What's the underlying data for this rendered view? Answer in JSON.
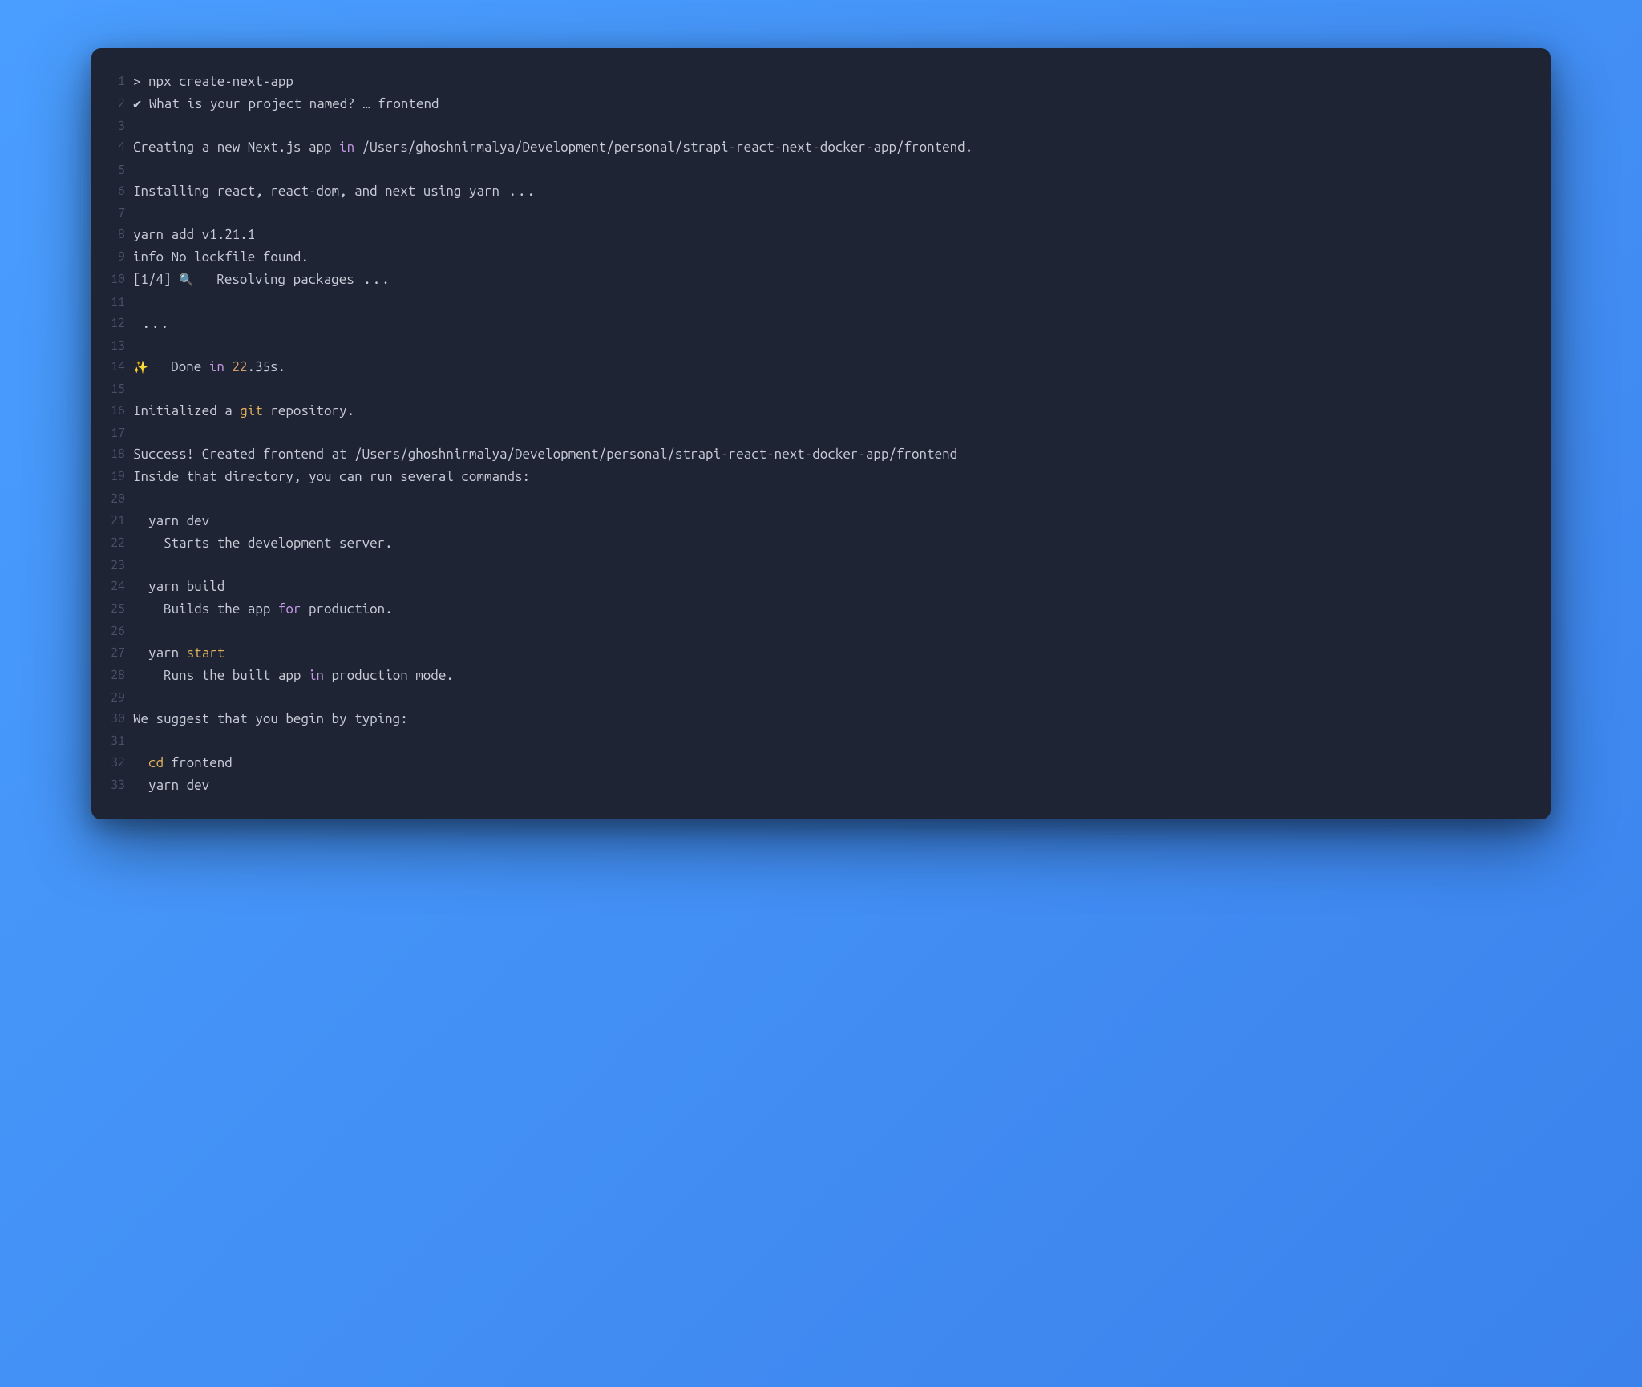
{
  "colors": {
    "bg_outer": "#3b82ec",
    "bg_terminal": "#1e2433",
    "text": "#c8cdd8",
    "lineno": "#4a5266",
    "keyword": "#c89ae8",
    "command": "#e2b35e",
    "number": "#d19a66"
  },
  "lines": [
    {
      "n": "1",
      "segs": [
        {
          "t": "> npx create-next-app"
        }
      ]
    },
    {
      "n": "2",
      "segs": [
        {
          "t": "✔ What is your project named? … frontend"
        }
      ]
    },
    {
      "n": "3",
      "segs": [
        {
          "t": ""
        }
      ]
    },
    {
      "n": "4",
      "segs": [
        {
          "t": "Creating a new Next.js app "
        },
        {
          "t": "in",
          "c": "kw"
        },
        {
          "t": " /Users/ghoshnirmalya/Development/personal/strapi-react-next-docker-app/frontend."
        }
      ]
    },
    {
      "n": "5",
      "segs": [
        {
          "t": ""
        }
      ]
    },
    {
      "n": "6",
      "segs": [
        {
          "t": "Installing react, react-dom, and next using yarn"
        },
        {
          "t": " ...",
          "c": "ellipsis"
        }
      ]
    },
    {
      "n": "7",
      "segs": [
        {
          "t": ""
        }
      ]
    },
    {
      "n": "8",
      "segs": [
        {
          "t": "yarn add v1.21.1"
        }
      ]
    },
    {
      "n": "9",
      "segs": [
        {
          "t": "info No lockfile found."
        }
      ]
    },
    {
      "n": "10",
      "segs": [
        {
          "t": "[1/4] "
        },
        {
          "t": "🔍",
          "c": "emoji"
        },
        {
          "t": "   Resolving packages"
        },
        {
          "t": " ...",
          "c": "ellipsis"
        }
      ]
    },
    {
      "n": "11",
      "segs": [
        {
          "t": ""
        }
      ]
    },
    {
      "n": "12",
      "segs": [
        {
          "t": " ...",
          "c": "ellipsis"
        }
      ]
    },
    {
      "n": "13",
      "segs": [
        {
          "t": ""
        }
      ]
    },
    {
      "n": "14",
      "segs": [
        {
          "t": "✨",
          "c": "emoji"
        },
        {
          "t": "   Done "
        },
        {
          "t": "in",
          "c": "kw"
        },
        {
          "t": " "
        },
        {
          "t": "22",
          "c": "num"
        },
        {
          "t": ".35s."
        }
      ]
    },
    {
      "n": "15",
      "segs": [
        {
          "t": ""
        }
      ]
    },
    {
      "n": "16",
      "segs": [
        {
          "t": "Initialized a "
        },
        {
          "t": "git",
          "c": "cmd"
        },
        {
          "t": " repository."
        }
      ]
    },
    {
      "n": "17",
      "segs": [
        {
          "t": ""
        }
      ]
    },
    {
      "n": "18",
      "segs": [
        {
          "t": "Success! Created frontend at /Users/ghoshnirmalya/Development/personal/strapi-react-next-docker-app/frontend"
        }
      ]
    },
    {
      "n": "19",
      "segs": [
        {
          "t": "Inside that directory, you can run several commands:"
        }
      ]
    },
    {
      "n": "20",
      "segs": [
        {
          "t": ""
        }
      ]
    },
    {
      "n": "21",
      "segs": [
        {
          "t": "  yarn dev"
        }
      ]
    },
    {
      "n": "22",
      "segs": [
        {
          "t": "    Starts the development server."
        }
      ]
    },
    {
      "n": "23",
      "segs": [
        {
          "t": ""
        }
      ]
    },
    {
      "n": "24",
      "segs": [
        {
          "t": "  yarn build"
        }
      ]
    },
    {
      "n": "25",
      "segs": [
        {
          "t": "    Builds the app "
        },
        {
          "t": "for",
          "c": "kw"
        },
        {
          "t": " production."
        }
      ]
    },
    {
      "n": "26",
      "segs": [
        {
          "t": ""
        }
      ]
    },
    {
      "n": "27",
      "segs": [
        {
          "t": "  yarn "
        },
        {
          "t": "start",
          "c": "cmd"
        }
      ]
    },
    {
      "n": "28",
      "segs": [
        {
          "t": "    Runs the built app "
        },
        {
          "t": "in",
          "c": "kw"
        },
        {
          "t": " production mode."
        }
      ]
    },
    {
      "n": "29",
      "segs": [
        {
          "t": ""
        }
      ]
    },
    {
      "n": "30",
      "segs": [
        {
          "t": "We suggest that you begin by typing:"
        }
      ]
    },
    {
      "n": "31",
      "segs": [
        {
          "t": ""
        }
      ]
    },
    {
      "n": "32",
      "segs": [
        {
          "t": "  "
        },
        {
          "t": "cd",
          "c": "cmd"
        },
        {
          "t": " frontend"
        }
      ]
    },
    {
      "n": "33",
      "segs": [
        {
          "t": "  yarn dev"
        }
      ]
    }
  ]
}
